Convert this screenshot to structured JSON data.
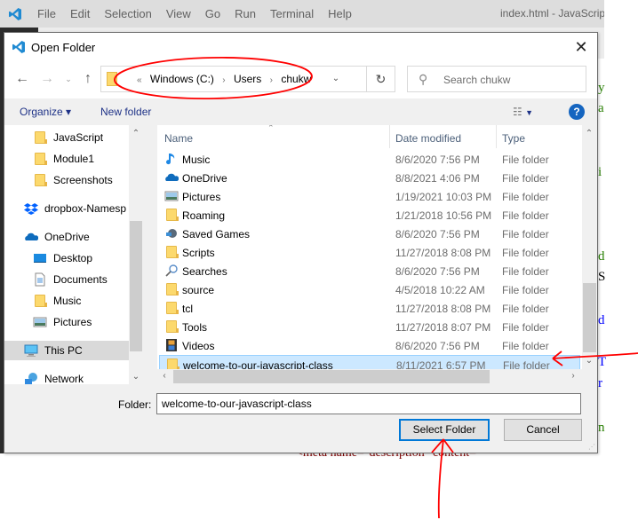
{
  "vscode": {
    "menu": [
      "File",
      "Edit",
      "Selection",
      "View",
      "Go",
      "Run",
      "Terminal",
      "Help"
    ],
    "window_title": "index.html - JavaScript"
  },
  "dialog": {
    "title": "Open Folder",
    "close_icon": "close-icon",
    "address": {
      "overflow": "«",
      "crumbs": [
        "Windows (C:)",
        "Users",
        "chukw"
      ]
    },
    "search_placeholder": "Search chukw",
    "toolbar": {
      "organize": "Organize ▾",
      "new_folder": "New folder",
      "help": "?"
    },
    "nav_pane": [
      {
        "label": "JavaScript",
        "icon": "folder",
        "indent": 1
      },
      {
        "label": "Module1",
        "icon": "folder",
        "indent": 1
      },
      {
        "label": "Screenshots",
        "icon": "folder",
        "indent": 1
      },
      {
        "label": "dropbox-Namesp",
        "icon": "dropbox",
        "indent": 0
      },
      {
        "label": "OneDrive",
        "icon": "onedrive",
        "indent": 0
      },
      {
        "label": "Desktop",
        "icon": "desktop",
        "indent": 1
      },
      {
        "label": "Documents",
        "icon": "documents",
        "indent": 1
      },
      {
        "label": "Music",
        "icon": "folder",
        "indent": 1
      },
      {
        "label": "Pictures",
        "icon": "pictures",
        "indent": 1
      },
      {
        "label": "This PC",
        "icon": "pc",
        "indent": 0,
        "selected": true
      },
      {
        "label": "Network",
        "icon": "network",
        "indent": 0
      }
    ],
    "columns": [
      "Name",
      "Date modified",
      "Type"
    ],
    "files": [
      {
        "name": "Music",
        "date": "8/6/2020 7:56 PM",
        "type": "File folder",
        "icon": "music"
      },
      {
        "name": "OneDrive",
        "date": "8/8/2021 4:06 PM",
        "type": "File folder",
        "icon": "onedrive"
      },
      {
        "name": "Pictures",
        "date": "1/19/2021 10:03 PM",
        "type": "File folder",
        "icon": "pictures"
      },
      {
        "name": "Roaming",
        "date": "1/21/2018 10:56 PM",
        "type": "File folder",
        "icon": "folder"
      },
      {
        "name": "Saved Games",
        "date": "8/6/2020 7:56 PM",
        "type": "File folder",
        "icon": "games"
      },
      {
        "name": "Scripts",
        "date": "11/27/2018 8:08 PM",
        "type": "File folder",
        "icon": "folder"
      },
      {
        "name": "Searches",
        "date": "8/6/2020 7:56 PM",
        "type": "File folder",
        "icon": "search"
      },
      {
        "name": "source",
        "date": "4/5/2018 10:22 AM",
        "type": "File folder",
        "icon": "folder"
      },
      {
        "name": "tcl",
        "date": "11/27/2018 8:08 PM",
        "type": "File folder",
        "icon": "folder"
      },
      {
        "name": "Tools",
        "date": "11/27/2018 8:07 PM",
        "type": "File folder",
        "icon": "folder"
      },
      {
        "name": "Videos",
        "date": "8/6/2020 7:56 PM",
        "type": "File folder",
        "icon": "videos"
      },
      {
        "name": "welcome-to-our-javascript-class",
        "date": "8/11/2021 6:57 PM",
        "type": "File folder",
        "icon": "folder",
        "selected": true
      }
    ],
    "folder_label": "Folder:",
    "folder_value": "welcome-to-our-javascript-class",
    "select_button": "Select Folder",
    "cancel_button": "Cancel"
  },
  "colors": {
    "accent": "#0078d7",
    "selection": "#cce8ff",
    "annotation": "#ff0000"
  }
}
